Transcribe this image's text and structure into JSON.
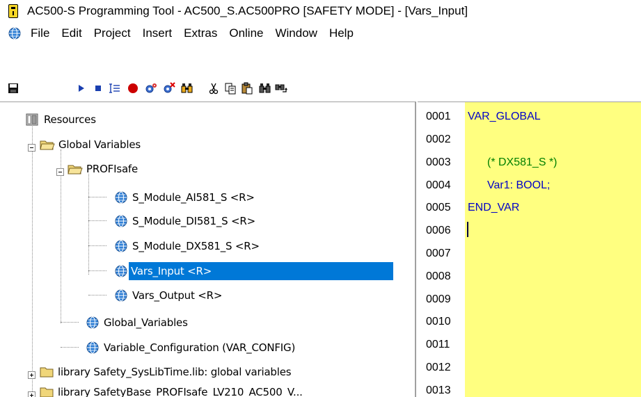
{
  "window": {
    "title": "AC500-S Programming Tool - AC500_S.AC500PRO [SAFETY MODE] - [Vars_Input]"
  },
  "menubar": {
    "items": [
      "File",
      "Edit",
      "Project",
      "Insert",
      "Extras",
      "Online",
      "Window",
      "Help"
    ]
  },
  "toolbar": {
    "buttons": [
      "save-icon",
      "run-icon",
      "stop-icon",
      "step-icon",
      "breakpoint-icon",
      "gear-icon",
      "gear-remove-icon",
      "binoculars-icon",
      "cut-icon",
      "copy-icon",
      "paste-icon",
      "find-icon",
      "find-next-icon"
    ]
  },
  "tree": {
    "resources": "Resources",
    "global_variables": "Global Variables",
    "profisafe": "PROFIsafe",
    "items": [
      "S_Module_AI581_S <R>",
      "S_Module_DI581_S <R>",
      "S_Module_DX581_S <R>",
      "Vars_Input <R>",
      "Vars_Output <R>"
    ],
    "global_variables_item": "Global_Variables",
    "variable_configuration": "Variable_Configuration (VAR_CONFIG)",
    "library1": "library Safety_SysLibTime.lib: global variables",
    "library2": "library SafetyBase_PROFIsafe_LV210_AC500_V..."
  },
  "editor": {
    "line_numbers": [
      "0001",
      "0002",
      "0003",
      "0004",
      "0005",
      "0006",
      "0007",
      "0008",
      "0009",
      "0010",
      "0011",
      "0012",
      "0013"
    ],
    "code": {
      "line1": "VAR_GLOBAL",
      "line3": "(* DX581_S *)",
      "line4_name": "Var1: ",
      "line4_type": "BOOL;",
      "line5": "END_VAR"
    }
  },
  "colors": {
    "selection": "#0078d7",
    "editor_bg": "#ffff80",
    "keyword": "#0000c8",
    "comment": "#008000"
  }
}
